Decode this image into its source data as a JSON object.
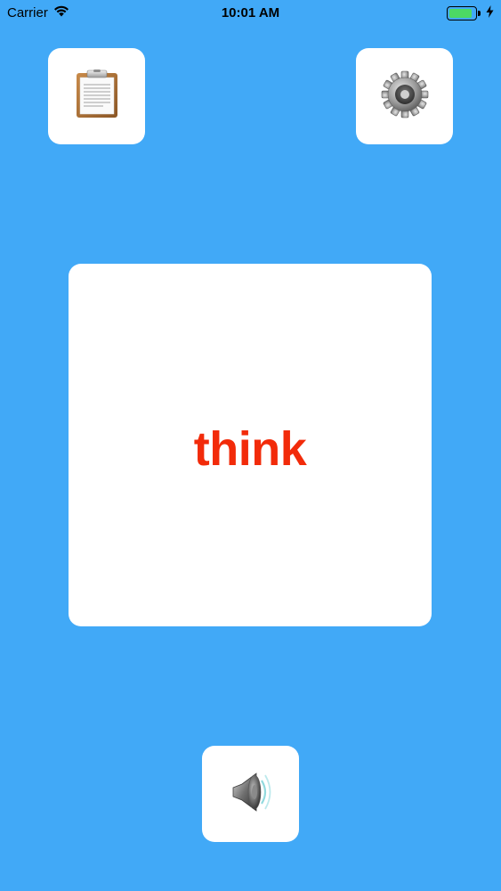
{
  "status_bar": {
    "carrier": "Carrier",
    "time": "10:01 AM",
    "battery_level": 0.9,
    "wifi_icon": "wifi-icon",
    "charging_icon": "bolt-icon"
  },
  "toolbar": {
    "left_icon": "clipboard-icon",
    "right_icon": "gear-icon"
  },
  "card": {
    "word": "think",
    "word_color": "#f22b0a"
  },
  "bottom": {
    "icon": "speaker-icon"
  },
  "colors": {
    "background": "#41a9f7",
    "card": "#ffffff"
  }
}
